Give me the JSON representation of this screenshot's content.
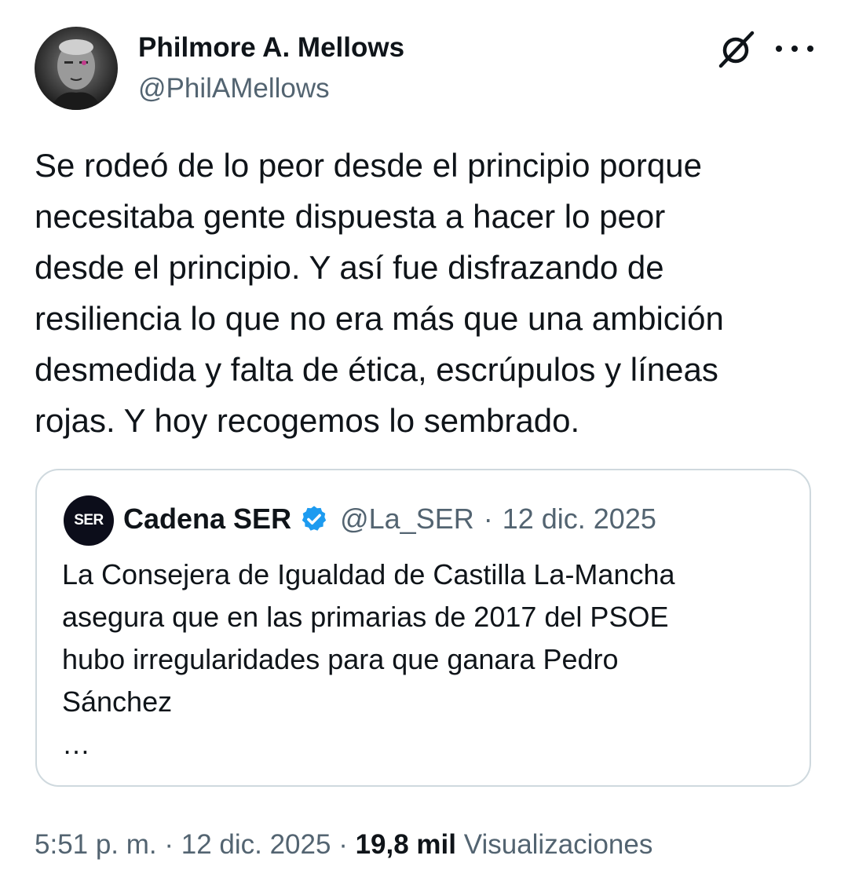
{
  "author": {
    "display_name": "Philmore A. Mellows",
    "handle": "@PhilAMellows"
  },
  "icons": {
    "grok": "grok-icon",
    "more": "more-options-icon",
    "verified": "verified-badge-icon",
    "verified_color": "#1d9bf0"
  },
  "tweet": {
    "text": "Se rodeó de lo peor desde el principio porque\nnecesitaba gente dispuesta a hacer lo peor\ndesde el principio. Y así fue disfrazando de\nresiliencia lo que no era más que una ambición\ndesmedida y falta de ética, escrúpulos y líneas\nrojas. Y hoy recogemos lo sembrado."
  },
  "quoted_tweet": {
    "avatar_text": "SER",
    "name": "Cadena SER",
    "handle": "@La_SER",
    "separator": "·",
    "date": "12 dic. 2025",
    "text": "La Consejera de Igualdad de Castilla La-Mancha\nasegura que en las primarias de 2017 del PSOE\nhubo irregularidades para que ganara Pedro\nSánchez\n…"
  },
  "meta": {
    "time": "5:51 p. m.",
    "sep1": " · ",
    "date": "12 dic. 2025",
    "sep2": " · ",
    "views_count": "19,8 mil",
    "views_label": "Visualizaciones"
  }
}
